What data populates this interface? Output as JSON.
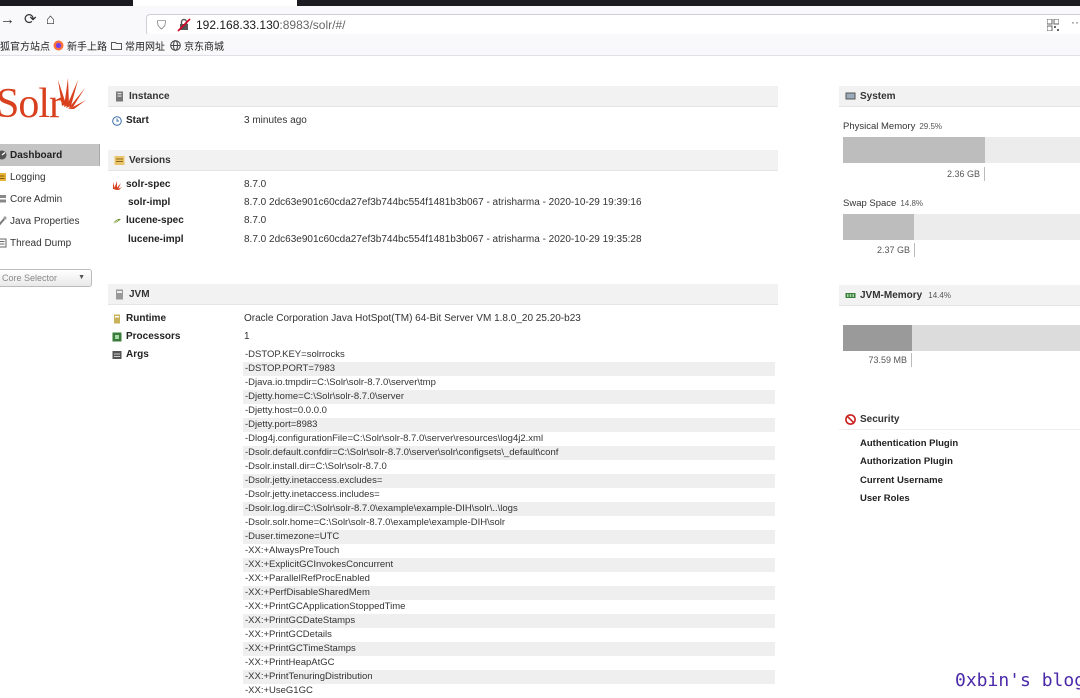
{
  "browser": {
    "url_host": "192.168.33.130",
    "url_rest": ":8983/solr/#/",
    "bookmarks": [
      "狐官方站点",
      "新手上路",
      "常用网址",
      "京东商城"
    ]
  },
  "logo": {
    "text": "Solr"
  },
  "nav": {
    "items": [
      {
        "label": "Dashboard"
      },
      {
        "label": "Logging"
      },
      {
        "label": "Core Admin"
      },
      {
        "label": "Java Properties"
      },
      {
        "label": "Thread Dump"
      }
    ],
    "core_selector": "Core Selector"
  },
  "instance": {
    "title": "Instance",
    "start_label": "Start",
    "start_value": "3 minutes ago"
  },
  "versions": {
    "title": "Versions",
    "rows": [
      {
        "label": "solr-spec",
        "value": "8.7.0"
      },
      {
        "label": "solr-impl",
        "value": "8.7.0 2dc63e901c60cda27ef3b744bc554f1481b3b067 - atrisharma - 2020-10-29 19:39:16"
      },
      {
        "label": "lucene-spec",
        "value": "8.7.0"
      },
      {
        "label": "lucene-impl",
        "value": "8.7.0 2dc63e901c60cda27ef3b744bc554f1481b3b067 - atrisharma - 2020-10-29 19:35:28"
      }
    ]
  },
  "jvm": {
    "title": "JVM",
    "runtime_label": "Runtime",
    "runtime_value": "Oracle Corporation Java HotSpot(TM) 64-Bit Server VM 1.8.0_20 25.20-b23",
    "processors_label": "Processors",
    "processors_value": "1",
    "args_label": "Args",
    "args": [
      "-DSTOP.KEY=solrrocks",
      "-DSTOP.PORT=7983",
      "-Djava.io.tmpdir=C:\\Solr\\solr-8.7.0\\server\\tmp",
      "-Djetty.home=C:\\Solr\\solr-8.7.0\\server",
      "-Djetty.host=0.0.0.0",
      "-Djetty.port=8983",
      "-Dlog4j.configurationFile=C:\\Solr\\solr-8.7.0\\server\\resources\\log4j2.xml",
      "-Dsolr.default.confdir=C:\\Solr\\solr-8.7.0\\server\\solr\\configsets\\_default\\conf",
      "-Dsolr.install.dir=C:\\Solr\\solr-8.7.0",
      "-Dsolr.jetty.inetaccess.excludes=",
      "-Dsolr.jetty.inetaccess.includes=",
      "-Dsolr.log.dir=C:\\Solr\\solr-8.7.0\\example\\example-DIH\\solr\\..\\logs",
      "-Dsolr.solr.home=C:\\Solr\\solr-8.7.0\\example\\example-DIH\\solr",
      "-Duser.timezone=UTC",
      "-XX:+AlwaysPreTouch",
      "-XX:+ExplicitGCInvokesConcurrent",
      "-XX:+ParallelRefProcEnabled",
      "-XX:+PerfDisableSharedMem",
      "-XX:+PrintGCApplicationStoppedTime",
      "-XX:+PrintGCDateStamps",
      "-XX:+PrintGCDetails",
      "-XX:+PrintGCTimeStamps",
      "-XX:+PrintHeapAtGC",
      "-XX:+PrintTenuringDistribution",
      "-XX:+UseG1GC"
    ]
  },
  "system": {
    "title": "System",
    "physical_label": "Physical Memory",
    "physical_pct": "29.5%",
    "physical_fraction": 0.295,
    "physical_used": "2.36 GB",
    "swap_label": "Swap Space",
    "swap_pct": "14.8%",
    "swap_fraction": 0.148,
    "swap_used": "2.37 GB"
  },
  "jvm_memory": {
    "title": "JVM-Memory",
    "pct": "14.4%",
    "fraction": 0.144,
    "used": "73.59 MB"
  },
  "security": {
    "title": "Security",
    "items": [
      "Authentication Plugin",
      "Authorization Plugin",
      "Current Username",
      "User Roles"
    ]
  },
  "watermark": "0xbin's blog",
  "colors": {
    "solr_orange": "#d9411e",
    "active_nav": "#c4c4c4",
    "watermark": "#4b2aa8"
  }
}
